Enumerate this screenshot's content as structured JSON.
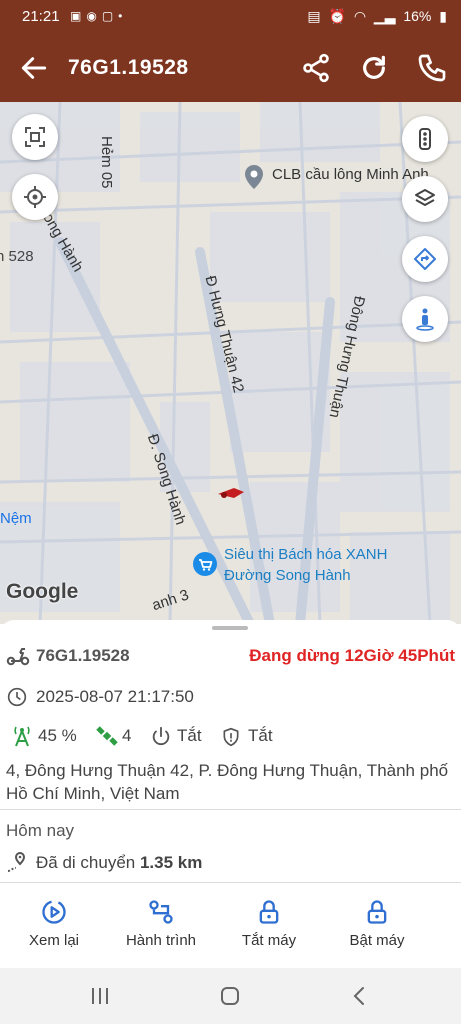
{
  "status_bar": {
    "time": "21:21",
    "notif_icons": [
      "image-icon",
      "messenger-icon",
      "zalo-icon",
      "dot-icon"
    ],
    "battery": "16%"
  },
  "app_bar": {
    "title": "76G1.19528",
    "color": "#7d3520"
  },
  "map": {
    "labels": {
      "hem05": "Hẻm 05",
      "song_hanh_top": "ong Hành",
      "label_528": "n 528",
      "hung_thuan_42": "Đ Hưng Thuận 42",
      "dong_hung_thuan": "Đông Hưng Thuận",
      "song_hanh_mid": "Đ. Song Hành",
      "nem": "Nệm",
      "hanh3": "anh 3"
    },
    "poi_clb": "CLB cầu lông Minh Anh",
    "poi_bhx_line1": "Siêu thị Bách hóa XANH",
    "poi_bhx_line2": "Đường Song Hành",
    "attribution": "Google"
  },
  "sheet": {
    "vehicle_name": "76G1.19528",
    "status": "Đang dừng 12Giờ 45Phút",
    "status_color": "#e02424",
    "timestamp": "2025-08-07 21:17:50",
    "signal": "45 %",
    "satellites": "4",
    "power": "Tắt",
    "shield": "Tắt",
    "address": "4, Đông Hưng Thuận 42, P. Đông Hưng Thuận, Thành phố Hồ Chí Minh, Việt Nam",
    "today_label": "Hôm nay",
    "moved_label": "Đã di chuyển",
    "moved_value": "1.35 km"
  },
  "actions": {
    "replay": "Xem lại",
    "journey": "Hành trình",
    "engine_off": "Tắt máy",
    "engine_on": "Bật máy"
  }
}
